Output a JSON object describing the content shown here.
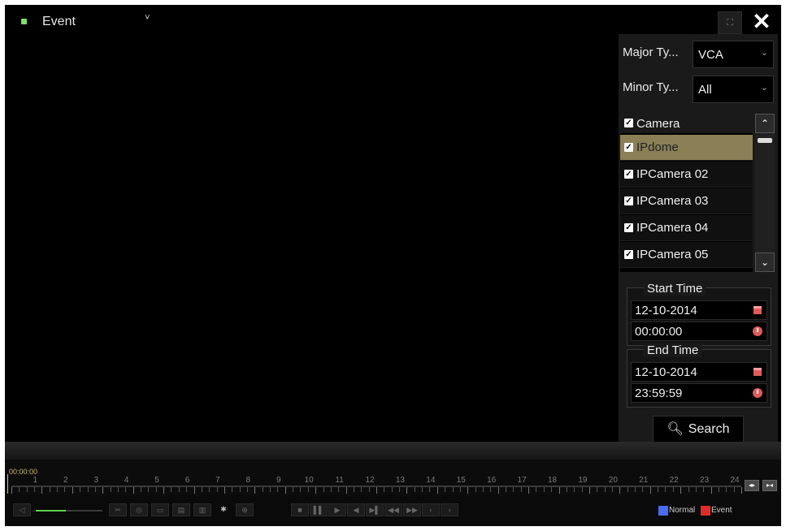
{
  "topbar": {
    "mode_label": "Event",
    "mode_chevron": "˅",
    "fullscreen_glyph": "⛶",
    "close_glyph": "✕"
  },
  "filters": {
    "major_type_label": "Major Ty...",
    "major_type_value": "VCA",
    "minor_type_label": "Minor Ty...",
    "minor_type_value": "All"
  },
  "camera_list": {
    "header": "Camera",
    "items": [
      {
        "label": "IPdome",
        "checked": true,
        "selected": true
      },
      {
        "label": "IPCamera 02",
        "checked": true,
        "selected": false
      },
      {
        "label": "IPCamera 03",
        "checked": true,
        "selected": false
      },
      {
        "label": "IPCamera 04",
        "checked": true,
        "selected": false
      },
      {
        "label": "IPCamera 05",
        "checked": true,
        "selected": false
      }
    ]
  },
  "start": {
    "title": "Start Time",
    "date": "12-10-2014",
    "time": "00:00:00"
  },
  "end": {
    "title": "End Time",
    "date": "12-10-2014",
    "time": "23:59:59"
  },
  "search_label": "Search",
  "timeline": {
    "current": "00:00:00",
    "hours": [
      "1",
      "2",
      "3",
      "4",
      "5",
      "6",
      "7",
      "8",
      "9",
      "10",
      "11",
      "12",
      "13",
      "14",
      "15",
      "16",
      "17",
      "18",
      "19",
      "20",
      "21",
      "22",
      "23",
      "24"
    ]
  },
  "legend": {
    "normal": "Normal",
    "event": "Event",
    "normal_color": "#4a6cf0",
    "event_color": "#e32a2a"
  },
  "colors": {
    "selected_row": "#8a7f55",
    "volume_fill": "#5fcf4f"
  },
  "volume_level": 0.45
}
